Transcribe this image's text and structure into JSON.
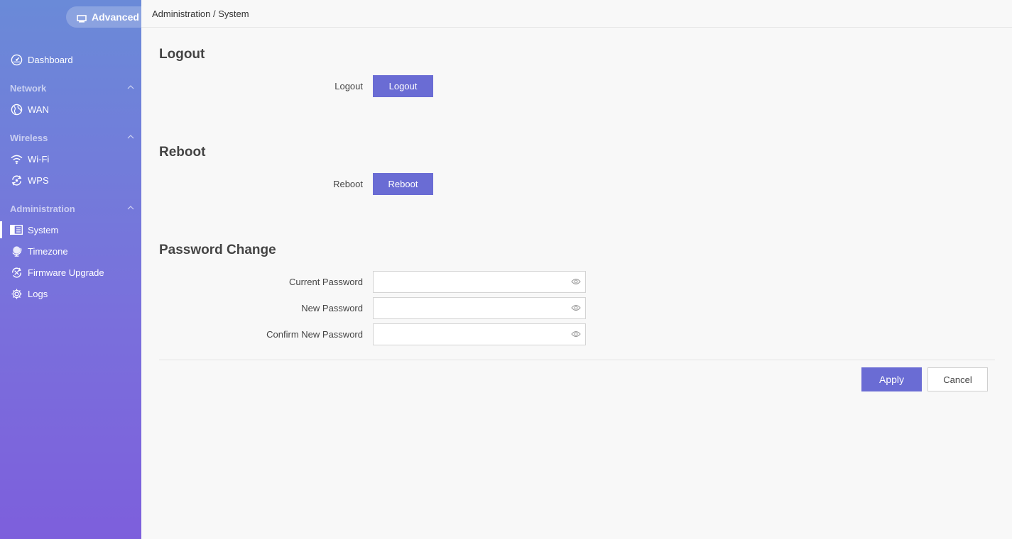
{
  "sidebar": {
    "mode_label": "Advanced",
    "items": {
      "dashboard": "Dashboard",
      "network_section": "Network",
      "wan": "WAN",
      "wireless_section": "Wireless",
      "wifi": "Wi-Fi",
      "wps": "WPS",
      "administration_section": "Administration",
      "system": "System",
      "timezone": "Timezone",
      "firmware": "Firmware Upgrade",
      "logs": "Logs"
    }
  },
  "header": {
    "breadcrumb": "Administration / System"
  },
  "logout": {
    "title": "Logout",
    "label": "Logout",
    "button": "Logout"
  },
  "reboot": {
    "title": "Reboot",
    "label": "Reboot",
    "button": "Reboot"
  },
  "password": {
    "title": "Password Change",
    "current_label": "Current Password",
    "current_value": "",
    "new_label": "New Password",
    "new_value": "",
    "confirm_label": "Confirm New Password",
    "confirm_value": ""
  },
  "actions": {
    "apply": "Apply",
    "cancel": "Cancel"
  },
  "colors": {
    "accent": "#6a6cd4",
    "sidebar_top": "#6a8ad8",
    "sidebar_bottom": "#7d5fdc"
  }
}
